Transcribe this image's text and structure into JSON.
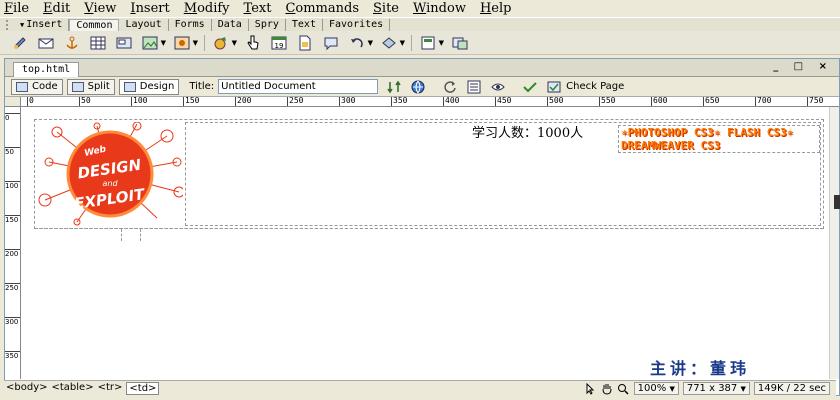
{
  "menu": [
    "File",
    "Edit",
    "View",
    "Insert",
    "Modify",
    "Text",
    "Commands",
    "Site",
    "Window",
    "Help"
  ],
  "insert_bar": {
    "label": "Insert",
    "tabs": [
      "Common",
      "Layout",
      "Forms",
      "Data",
      "Spry",
      "Text",
      "Favorites"
    ],
    "active_tab": "Common"
  },
  "document": {
    "tab_label": "top.html",
    "window_controls": "_ □ ×",
    "views": {
      "code": "Code",
      "split": "Split",
      "design": "Design"
    },
    "title_label": "Title:",
    "title_value": "Untitled Document",
    "check_page": "Check Page"
  },
  "ruler": {
    "h_labels": [
      "0",
      "50",
      "100",
      "150",
      "200",
      "250",
      "300",
      "350",
      "400",
      "450",
      "500",
      "550",
      "600",
      "650",
      "700",
      "750"
    ],
    "v_labels": [
      "0",
      "50",
      "100",
      "150",
      "200",
      "250",
      "300",
      "350"
    ]
  },
  "page": {
    "students_text": "学习人数：1000人",
    "courses_text": "✶PHOTOSHOP CS3✶ FLASH CS3✶ DREAMWEAVER CS3",
    "logo": {
      "line1": "Web",
      "line2": "DESIGN",
      "line3": "and",
      "line4": "EXPLOIT"
    },
    "lecturer": "主讲：董玮"
  },
  "status": {
    "tags": [
      "<body>",
      "<table>",
      "<tr>",
      "<td>"
    ],
    "current_tag": "<td>",
    "zoom": "100%",
    "dimensions": "771 x 387",
    "size": "149K / 22 sec"
  },
  "colors": {
    "accent_orange": "#ff7a00",
    "logo_red": "#e8391a",
    "lecturer_blue": "#1a3a8a"
  }
}
